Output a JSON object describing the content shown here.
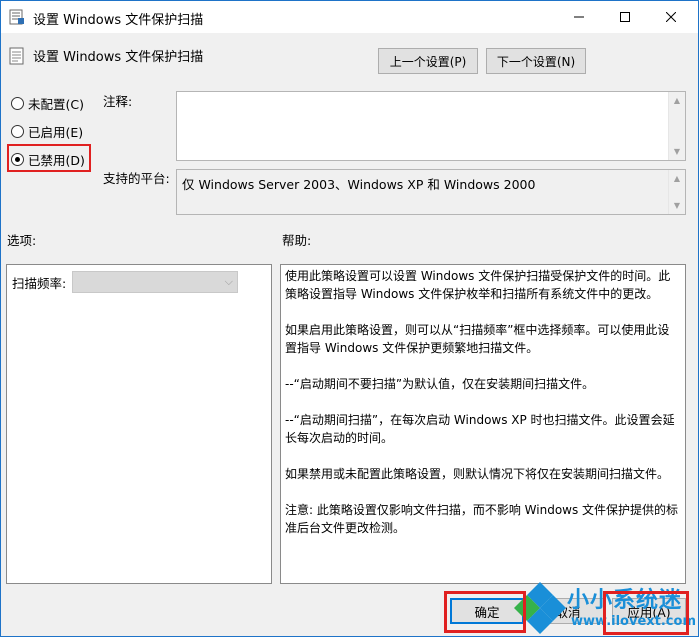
{
  "window": {
    "title": "设置 Windows 文件保护扫描",
    "controls": {
      "minimize": "minimize-icon",
      "maximize": "maximize-icon",
      "close": "close-icon"
    }
  },
  "header": {
    "title": "设置 Windows 文件保护扫描",
    "prev_label": "上一个设置(P)",
    "next_label": "下一个设置(N)"
  },
  "state": {
    "options": [
      {
        "label": "未配置(C)",
        "checked": false
      },
      {
        "label": "已启用(E)",
        "checked": false
      },
      {
        "label": "已禁用(D)",
        "checked": true
      }
    ]
  },
  "comment": {
    "label": "注释:",
    "value": ""
  },
  "platform": {
    "label": "支持的平台:",
    "value": "仅 Windows Server 2003、Windows XP 和 Windows 2000"
  },
  "options_section": {
    "label": "选项:",
    "scan_freq_label": "扫描频率:",
    "scan_freq_value": ""
  },
  "help_section": {
    "label": "帮助:",
    "paragraphs": [
      "使用此策略设置可以设置 Windows 文件保护扫描受保护文件的时间。此策略设置指导 Windows 文件保护枚举和扫描所有系统文件中的更改。",
      "如果启用此策略设置，则可以从“扫描频率”框中选择频率。可以使用此设置指导 Windows 文件保护更频繁地扫描文件。",
      "--“启动期间不要扫描”为默认值，仅在安装期间扫描文件。",
      "--“启动期间扫描”，在每次启动 Windows XP 时也扫描文件。此设置会延长每次启动的时间。",
      "如果禁用或未配置此策略设置，则默认情况下将仅在安装期间扫描文件。",
      "注意: 此策略设置仅影响文件扫描，而不影响 Windows 文件保护提供的标准后台文件更改检测。"
    ]
  },
  "footer": {
    "ok_label": "确定",
    "cancel_label": "取消",
    "apply_label": "应用(A)"
  },
  "watermark": {
    "text": "小小系统迷",
    "url": "www.ilovext.com"
  },
  "colors": {
    "highlight": "#e02020",
    "accent": "#0078d7",
    "watermark": "#1a8fd8"
  }
}
